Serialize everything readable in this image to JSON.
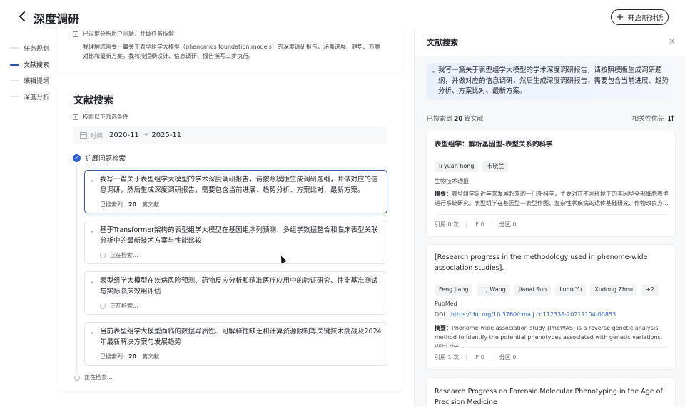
{
  "header": {
    "title": "深度调研",
    "new_chat_label": "开启新对话"
  },
  "steps": [
    {
      "label": "任务规划",
      "active": false
    },
    {
      "label": "文献搜索",
      "active": true
    },
    {
      "label": "编辑提纲",
      "active": false
    },
    {
      "label": "深度分析",
      "active": false
    }
  ],
  "analysis": {
    "done_label": "已深度分析用户问题，并做任务拆解",
    "understanding": "我理解您需要一篇关于表型组学大模型（phenomics foundation models）的深度调研报告，涵盖进展、趋势、方案对比和最新方案。我将按提纲设计、信息调研、报告撰写三步执行。"
  },
  "search": {
    "title": "文献搜索",
    "filter_label": "按照以下筛选条件",
    "date_label": "时间",
    "date_from": "2020-11",
    "date_to": "2025-11",
    "expand_label": "扩展问题检索",
    "queries": [
      {
        "text": "我写一篇关于表型组学大模型的学术深度调研报告，请按照模版生成调研题纲，并做对应的信息调研，然后生成深度调研报告，需要包含当前进展、趋势分析、方案比对、最新方案。",
        "status_prefix": "已搜索到",
        "count": "20",
        "status_suffix": "篇文献",
        "searching": false
      },
      {
        "text": "基于Transformer架构的表型组学大模型在基因组序列预测、多组学数据整合和临床表型关联分析中的最新技术方案与性能比较",
        "status": "正在检索...",
        "searching": true
      },
      {
        "text": "表型组学大模型在疾病风险预测、药物反应分析和精准医疗应用中的验证研究、性能基准测试与实际临床效用评估",
        "status": "正在检索...",
        "searching": true
      },
      {
        "text": "当前表型组学大模型面临的数据异质性、可解释性缺乏和计算资源限制等关键技术挑战及2024年最新解决方案与发展趋势",
        "status_prefix": "已搜索到",
        "count": "20",
        "status_suffix": "篇文献",
        "searching": false
      }
    ],
    "bottom_status": "正在检索..."
  },
  "panel": {
    "title": "文献搜索",
    "close_icon": "×",
    "query": "我写一篇关于表型组学大模型的学术深度调研报告，请按照模版生成调研题纲，并做对应的信息调研，然后生成深度调研报告，需要包含当前进展、趋势分析、方案比对、最新方案。",
    "found_prefix": "已搜索到",
    "found_count": "20",
    "found_suffix": "篇文献",
    "sort_label": "相关性优先",
    "papers": [
      {
        "title": "表型组学：解析基因型-表型关系的科学",
        "authors": [
          "li yuan hong",
          "韦晓兰"
        ],
        "journal": "生物技术通报",
        "abstract_label": "摘要：",
        "abstract": "表型组学是近年来发展起来的一门新科学，主要对在不同环境下的基因型全部细胞表型进行系统研究。表型组学在基因型—表型作图、复杂性状疾病的遗传基础研究、作物改良方...",
        "citations": "引用 0 次",
        "if": "IF 0",
        "zone": "分区 0"
      },
      {
        "title": "[Research progress in the methodology used in phenome-wide association studies].",
        "authors": [
          "Feng Jiang",
          "L J Wang",
          "Jianai Sun",
          "Luhu Yu",
          "Xudong Zhou",
          "+2"
        ],
        "journal": "PubMed",
        "doi_label": "DOI：",
        "doi": "https://doi.org/10.3760/cma.j.cn112338-20211104-00853",
        "abstract_label": "摘要：",
        "abstract": "Phenome-wide association study (PheWAS) is a reverse genetic analysis method to identify the potential phenotypes associated with genetic variations. With the...",
        "citations": "引用 1 次",
        "if": "IF 0",
        "zone": "分区 0"
      },
      {
        "title": "Research Progress on Forensic Molecular Phenotyping in the Age of Precision Medicine"
      }
    ]
  },
  "colors": {
    "accent": "#2d5fd8",
    "active_bar": "#2d4ea3",
    "panel_bg": "#f7f8fa"
  }
}
